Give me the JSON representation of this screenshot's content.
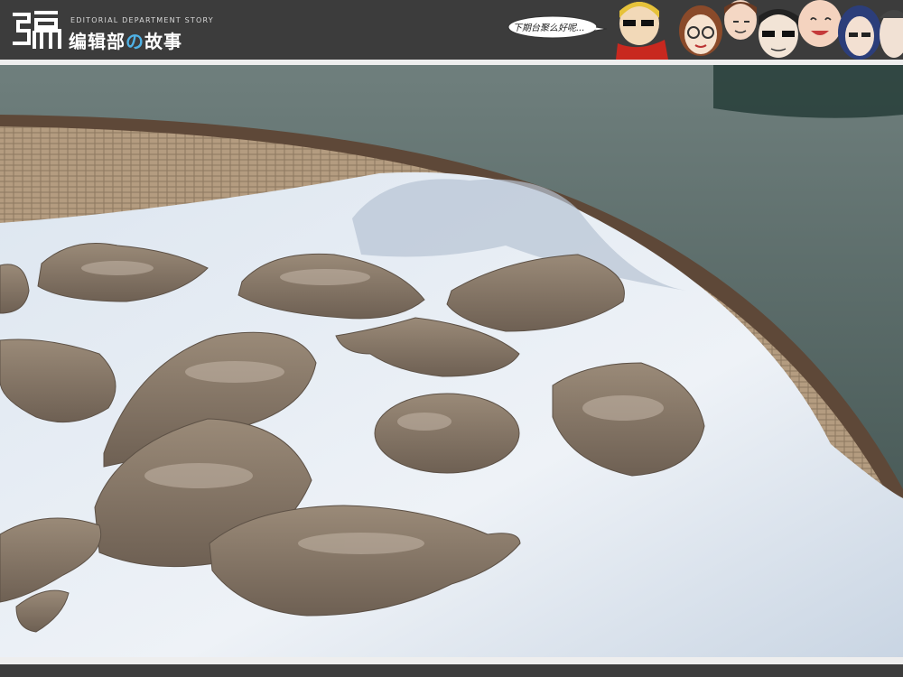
{
  "header": {
    "logo_mark": "编",
    "logo_en": "EDITORIAL DEPARTMENT STORY",
    "logo_cn_before": "编辑部",
    "logo_cn_accent": "の",
    "logo_cn_after": "故事",
    "bubble_text": "下期台聚么好呢...",
    "colors": {
      "bar": "#3c3c3c",
      "accent": "#4fb2e6"
    }
  },
  "photo": {
    "subject": "mud-cakes-on-cloth-in-bamboo-basket"
  }
}
